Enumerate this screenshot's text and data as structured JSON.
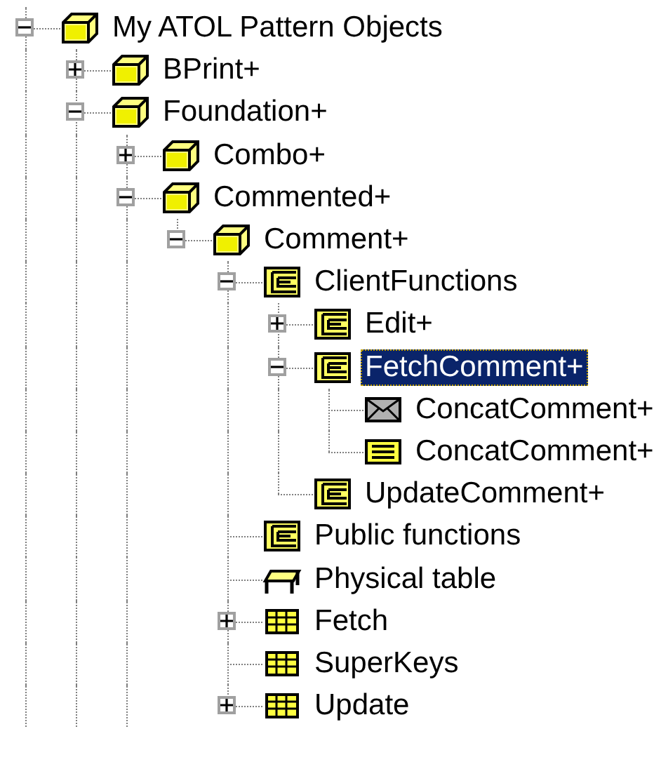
{
  "tree": [
    {
      "label": "My ATOL Pattern Objects",
      "kind": "object",
      "expanded": true,
      "selected": false,
      "more_above": true,
      "more_below": true,
      "children": [
        {
          "label": "BPrint+",
          "kind": "object",
          "expanded": false,
          "selected": false
        },
        {
          "label": "Foundation+",
          "kind": "object",
          "expanded": true,
          "selected": false,
          "more_below": true,
          "children": [
            {
              "label": "Combo+",
              "kind": "object",
              "expanded": false,
              "selected": false
            },
            {
              "label": "Commented+",
              "kind": "object",
              "expanded": true,
              "selected": false,
              "more_below": true,
              "children": [
                {
                  "label": "Comment+",
                  "kind": "object",
                  "expanded": true,
                  "selected": false,
                  "children": [
                    {
                      "label": "ClientFunctions",
                      "kind": "functions",
                      "expanded": true,
                      "selected": false,
                      "children": [
                        {
                          "label": "Edit+",
                          "kind": "functions",
                          "expanded": false,
                          "selected": false
                        },
                        {
                          "label": "FetchComment+",
                          "kind": "functions",
                          "expanded": true,
                          "selected": true,
                          "children": [
                            {
                              "label": "ConcatComment+",
                              "kind": "message",
                              "selected": false
                            },
                            {
                              "label": "ConcatComment+",
                              "kind": "method",
                              "selected": false
                            }
                          ]
                        },
                        {
                          "label": "UpdateComment+",
                          "kind": "functions",
                          "selected": false
                        }
                      ]
                    },
                    {
                      "label": "Public functions",
                      "kind": "functions",
                      "selected": false
                    },
                    {
                      "label": "Physical table",
                      "kind": "table",
                      "selected": false
                    },
                    {
                      "label": "Fetch",
                      "kind": "grid",
                      "expanded": false,
                      "selected": false
                    },
                    {
                      "label": "SuperKeys",
                      "kind": "grid",
                      "selected": false
                    },
                    {
                      "label": "Update",
                      "kind": "grid",
                      "expanded": false,
                      "selected": false
                    }
                  ]
                }
              ]
            }
          ]
        }
      ]
    }
  ]
}
